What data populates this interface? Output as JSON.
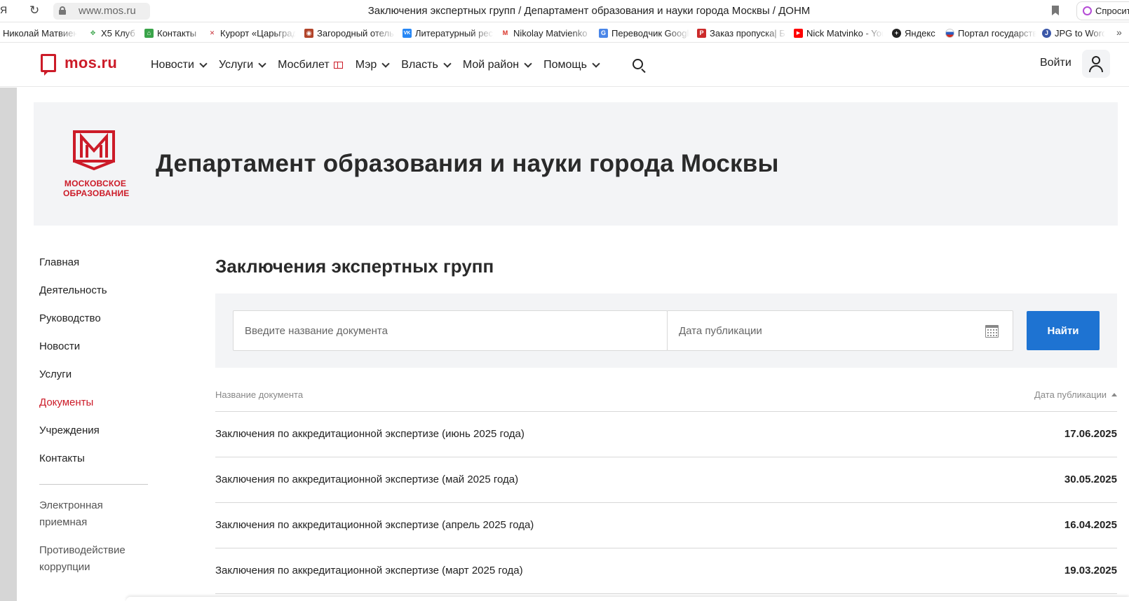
{
  "browser": {
    "logo": "Я",
    "url": "www.mos.ru",
    "title": "Заключения экспертных групп / Департамент образования и науки города Москвы / ДОНМ",
    "ask_label": "Спросить"
  },
  "bookmarks": [
    {
      "label": "Николай Матвиенко",
      "color": "#2b4f8a",
      "glyph": ""
    },
    {
      "label": "X5 Клуб",
      "color": "#3aa44a",
      "glyph": "✥"
    },
    {
      "label": "Контакты",
      "color": "#3aa44a",
      "glyph": "⌂"
    },
    {
      "label": "Курорт «Царьград»",
      "color": "#c8313a",
      "glyph": "✕"
    },
    {
      "label": "Загородный отель",
      "color": "#b2452b",
      "glyph": "◉"
    },
    {
      "label": "Литературный ресурс",
      "color": "#2787f5",
      "glyph": "VK"
    },
    {
      "label": "Nikolay Matvienko",
      "color": "#ffffff",
      "glyph": "M"
    },
    {
      "label": "Переводчик Google",
      "color": "#4a86e8",
      "glyph": "G"
    },
    {
      "label": "Заказ пропуска| Б",
      "color": "#cc2b2b",
      "glyph": "P"
    },
    {
      "label": "Nick Matvinko - YouTube",
      "color": "#ff0000",
      "glyph": "▶"
    },
    {
      "label": "Яндекс",
      "color": "#222222",
      "glyph": "+"
    },
    {
      "label": "Портал государственных услуг",
      "color": "#2a5cbf",
      "glyph": ""
    },
    {
      "label": "JPG to Word",
      "color": "#3b57a8",
      "glyph": "J"
    }
  ],
  "header": {
    "brand": "mos.ru",
    "nav": [
      "Новости",
      "Услуги",
      "Мосбилет",
      "Мэр",
      "Власть",
      "Мой район",
      "Помощь"
    ],
    "login": "Войти"
  },
  "department": {
    "logo_caption_1": "МОСКОВСКОЕ",
    "logo_caption_2": "ОБРАЗОВАНИЕ",
    "title": "Департамент образования и науки города Москвы"
  },
  "sidebar": {
    "items": [
      "Главная",
      "Деятельность",
      "Руководство",
      "Новости",
      "Услуги",
      "Документы",
      "Учреждения",
      "Контакты"
    ],
    "active_index": 5,
    "secondary": [
      "Электронная приемная",
      "Противодействие коррупции"
    ]
  },
  "main": {
    "title": "Заключения экспертных групп",
    "search": {
      "name_placeholder": "Введите название документа",
      "date_placeholder": "Дата публикации",
      "button": "Найти"
    },
    "table": {
      "col_name": "Название документа",
      "col_date": "Дата публикации",
      "rows": [
        {
          "title": "Заключения по аккредитационной экспертизе (июнь 2025 года)",
          "date": "17.06.2025"
        },
        {
          "title": "Заключения по аккредитационной экспертизе (май 2025 года)",
          "date": "30.05.2025"
        },
        {
          "title": "Заключения по аккредитационной экспертизе (апрель 2025 года)",
          "date": "16.04.2025"
        },
        {
          "title": "Заключения по аккредитационной экспертизе (март 2025 года)",
          "date": "19.03.2025"
        }
      ]
    }
  },
  "colors": {
    "brand_red": "#cc1b28",
    "button_blue": "#1e73d2",
    "panel_gray": "#f3f4f6"
  }
}
